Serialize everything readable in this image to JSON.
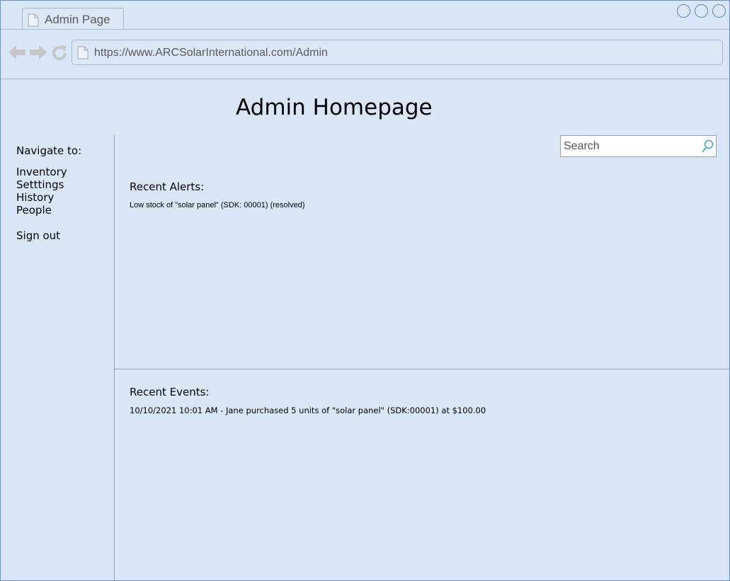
{
  "browser": {
    "tab_title": "Admin Page",
    "url": "https://www.ARCSolarInternational.com/Admin"
  },
  "page": {
    "title": "Admin Homepage"
  },
  "sidebar": {
    "heading": "Navigate to:",
    "links": [
      "Inventory",
      "Setttings",
      "History",
      "People"
    ],
    "sign_out": "Sign out"
  },
  "search": {
    "placeholder": "Search"
  },
  "alerts": {
    "heading": "Recent Alerts:",
    "items": [
      "Low stock of \"solar panel\" (SDK: 00001) (resolved)"
    ]
  },
  "events": {
    "heading": "Recent Events:",
    "items": [
      "10/10/2021 10:01 AM - Jane purchased 5 units of \"solar panel\" (SDK:00001) at $100.00"
    ]
  },
  "colors": {
    "background": "#d8e6f8",
    "window_button_border": "#5a86c8"
  }
}
